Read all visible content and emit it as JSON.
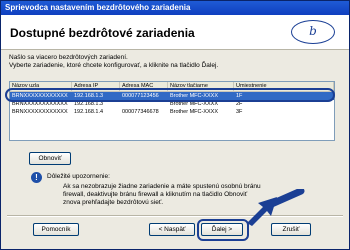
{
  "window": {
    "title": "Sprievodca nastavením bezdrôtového zariadenia"
  },
  "header": {
    "title": "Dostupné bezdrôtové zariadenia",
    "logo_text": "brother-logo"
  },
  "intro": {
    "line1": "Našlo sa viacero bezdrôtových zariadení.",
    "line2": "Vyberte zariadenie, ktoré chcete konfigurovať, a kliknite na tlačidlo Ďalej."
  },
  "table": {
    "columns": [
      "Názov uzla",
      "Adresa IP",
      "Adresa MAC",
      "Názov tlačiarne",
      "Umiestnenie"
    ],
    "rows": [
      [
        "BRNXXXXXXXXXXXX",
        "192.168.1.3",
        "000077123456",
        "Brother MFC-XXXX",
        "1F"
      ],
      [
        "BRNXXXXXXXXXXXX",
        "192.168.1.3",
        "",
        "Brother MFC-XXXX",
        "2F"
      ],
      [
        "BRNXXXXXXXXXXXX",
        "192.168.1.4",
        "000077346678",
        "Brother MFC-XXXX",
        "3F"
      ]
    ]
  },
  "buttons": {
    "refresh": "Obnoviť",
    "help": "Pomocník",
    "back": "< Naspäť",
    "next": "Ďalej >",
    "finish": "Zrušiť"
  },
  "note": {
    "label": "Dôležité upozornenie:",
    "line1": "Ak sa nezobrazuje žiadne zariadenie a máte spustenú osobnú bránu",
    "line2": "firewall, deaktivujte bránu firewall a kliknutím na tlačidlo Obnoviť",
    "line3": "znova prehľadajte bezdrôtovú sieť."
  },
  "colors": {
    "selection": "#316ac5",
    "highlight_ring": "#1b3f94",
    "titlebar": "#1f5bd6"
  }
}
